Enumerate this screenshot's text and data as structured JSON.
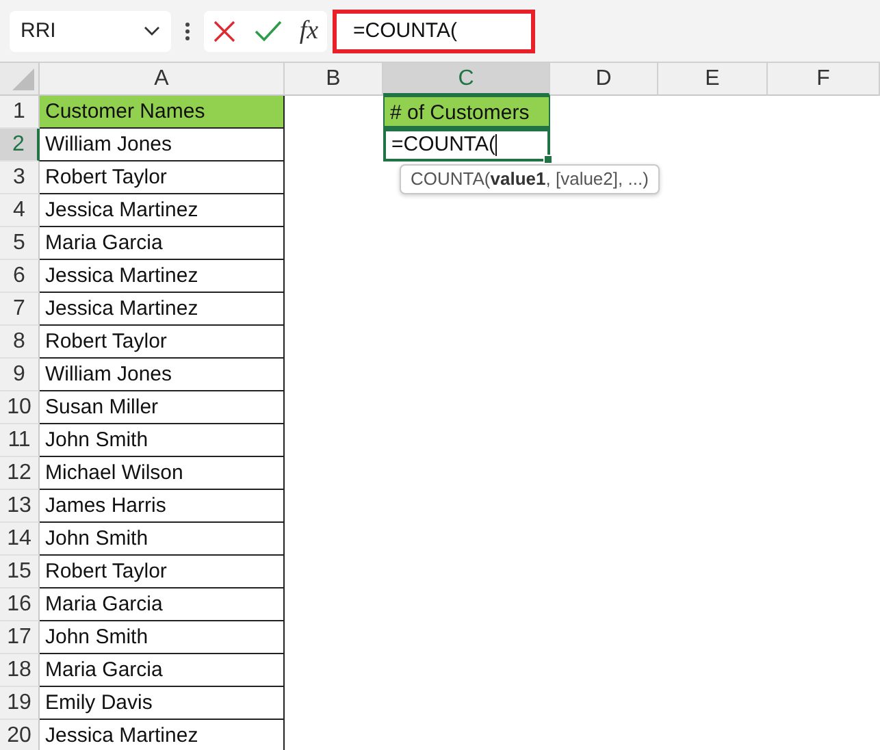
{
  "name_box": {
    "value": "RRI"
  },
  "formula_bar": {
    "function_label": "fx",
    "value": "=COUNTA(",
    "highlighted": true
  },
  "columns": [
    {
      "label": "A",
      "selected": false
    },
    {
      "label": "B",
      "selected": false
    },
    {
      "label": "C",
      "selected": true
    },
    {
      "label": "D",
      "selected": false
    },
    {
      "label": "E",
      "selected": false
    },
    {
      "label": "F",
      "selected": false
    }
  ],
  "rows": [
    {
      "number": "1",
      "selected": false,
      "kind": "header",
      "a": "Customer Names",
      "c": "# of Customers"
    },
    {
      "number": "2",
      "selected": true,
      "kind": "edit",
      "a": "William Jones",
      "c": "=COUNTA("
    },
    {
      "number": "3",
      "selected": false,
      "kind": "data",
      "a": "Robert Taylor"
    },
    {
      "number": "4",
      "selected": false,
      "kind": "data",
      "a": "Jessica Martinez"
    },
    {
      "number": "5",
      "selected": false,
      "kind": "data",
      "a": "Maria Garcia"
    },
    {
      "number": "6",
      "selected": false,
      "kind": "data",
      "a": "Jessica Martinez"
    },
    {
      "number": "7",
      "selected": false,
      "kind": "data",
      "a": "Jessica Martinez"
    },
    {
      "number": "8",
      "selected": false,
      "kind": "data",
      "a": "Robert Taylor"
    },
    {
      "number": "9",
      "selected": false,
      "kind": "data",
      "a": "William Jones"
    },
    {
      "number": "10",
      "selected": false,
      "kind": "data",
      "a": "Susan Miller"
    },
    {
      "number": "11",
      "selected": false,
      "kind": "data",
      "a": "John Smith"
    },
    {
      "number": "12",
      "selected": false,
      "kind": "data",
      "a": "Michael Wilson"
    },
    {
      "number": "13",
      "selected": false,
      "kind": "data",
      "a": "James Harris"
    },
    {
      "number": "14",
      "selected": false,
      "kind": "data",
      "a": "John Smith"
    },
    {
      "number": "15",
      "selected": false,
      "kind": "data",
      "a": "Robert Taylor"
    },
    {
      "number": "16",
      "selected": false,
      "kind": "data",
      "a": "Maria Garcia"
    },
    {
      "number": "17",
      "selected": false,
      "kind": "data",
      "a": "John Smith"
    },
    {
      "number": "18",
      "selected": false,
      "kind": "data",
      "a": "Maria Garcia"
    },
    {
      "number": "19",
      "selected": false,
      "kind": "data",
      "a": "Emily Davis"
    },
    {
      "number": "20",
      "selected": false,
      "kind": "data",
      "a": "Jessica Martinez"
    }
  ],
  "tooltip": "COUNTA(**value1**, [value2], ...)"
}
